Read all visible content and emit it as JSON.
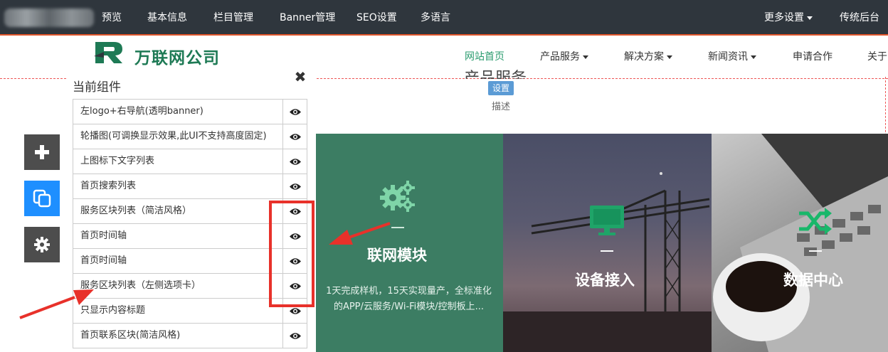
{
  "topbar": {
    "items": [
      "预览",
      "基本信息",
      "栏目管理",
      "Banner管理",
      "SEO设置",
      "多语言"
    ],
    "more_settings": "更多设置",
    "legacy_admin": "传统后台"
  },
  "site": {
    "brand": "万联网公司",
    "nav": [
      {
        "label": "网站首页",
        "active": true,
        "dropdown": false
      },
      {
        "label": "产品服务",
        "active": false,
        "dropdown": true
      },
      {
        "label": "解决方案",
        "active": false,
        "dropdown": true
      },
      {
        "label": "新闻资讯",
        "active": false,
        "dropdown": true
      },
      {
        "label": "申请合作",
        "active": false,
        "dropdown": false
      },
      {
        "label": "关于",
        "active": false,
        "dropdown": false
      }
    ],
    "accent_color": "#2a9b6e"
  },
  "section": {
    "title": "产品服务",
    "settings_badge": "设置",
    "description": "描述"
  },
  "cards": [
    {
      "title": "联网模块",
      "icon": "gears-icon",
      "desc": "1天完成样机，15天实现量产，全标准化的APP/云服务/Wi-Fi模块/控制板上..."
    },
    {
      "title": "设备接入",
      "icon": "monitor-icon",
      "desc": ""
    },
    {
      "title": "数据中心",
      "icon": "shuffle-icon",
      "desc": ""
    }
  ],
  "tools": [
    "plus-icon",
    "copy-icon",
    "gear-icon"
  ],
  "panel": {
    "title": "当前组件",
    "close": "✖",
    "components": [
      "左logo+右导航(透明banner)",
      "轮播图(可调换显示效果,此UI不支持高度固定)",
      "上图标下文字列表",
      "首页搜索列表",
      "服务区块列表（简洁风格）",
      "首页时间轴",
      "首页时间轴",
      "服务区块列表（左侧选项卡）",
      "只显示内容标题",
      "首页联系区块(简洁风格)"
    ]
  },
  "colors": {
    "topbar_bg": "#2f363d",
    "topbar_border": "#e2562b",
    "tool_blue": "#1e8fff",
    "annotation_red": "#e8312a"
  }
}
